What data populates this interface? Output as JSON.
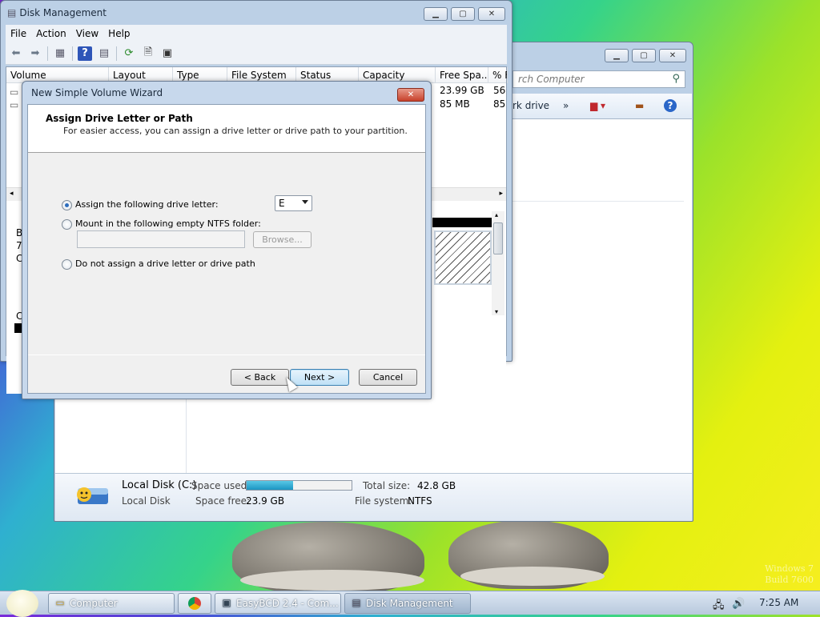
{
  "desktop": {
    "watermark_line1": "Windows 7",
    "watermark_line2": "Build 7600"
  },
  "explorer": {
    "search_placeholder": "rch Computer",
    "toolbar_network_drive": "rk drive",
    "toolbar_more": "»",
    "details": {
      "name": "Local Disk (C:)",
      "type": "Local Disk",
      "space_used_label": "Space used:",
      "space_used_fraction": 0.44,
      "space_free_label": "Space free:",
      "space_free_value": "23.9 GB",
      "total_size_label": "Total size:",
      "total_size_value": "42.8 GB",
      "file_system_label": "File system:",
      "file_system_value": "NTFS"
    }
  },
  "disk_management": {
    "title": "Disk Management",
    "menu": [
      "File",
      "Action",
      "View",
      "Help"
    ],
    "columns": [
      "Volume",
      "Layout",
      "Type",
      "File System",
      "Status",
      "Capacity",
      "Free Spa...",
      "% F"
    ],
    "rows": [
      {
        "free_space": "23.99 GB",
        "pct_free": "56"
      },
      {
        "free_space": "85 MB",
        "pct_free": "85"
      }
    ],
    "left_pane_chars": [
      "B",
      "7",
      "C",
      "C"
    ]
  },
  "wizard": {
    "title": "New Simple Volume Wizard",
    "heading": "Assign Drive Letter or Path",
    "subheading": "For easier access, you can assign a drive letter or drive path to your partition.",
    "option_assign": "Assign the following drive letter:",
    "drive_letter": "E",
    "option_mount": "Mount in the following empty NTFS folder:",
    "browse": "Browse...",
    "option_none": "Do not assign a drive letter or drive path",
    "back": "< Back",
    "next": "Next >",
    "cancel": "Cancel"
  },
  "taskbar": {
    "items": [
      "Computer",
      "EasyBCD 2.4 - Com...",
      "Disk Management"
    ],
    "clock": "7:25 AM"
  },
  "colors": {
    "accent_blue": "#2d6dbd",
    "progress_fill": "#1c95c2"
  }
}
